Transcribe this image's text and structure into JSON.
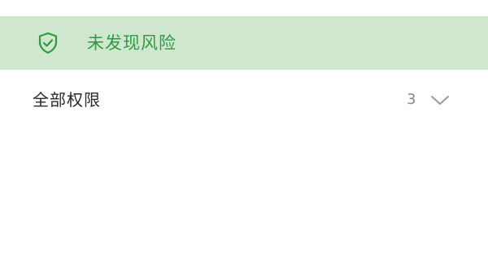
{
  "banner": {
    "status_icon": "shield-check-icon",
    "status_text": "未发现风险",
    "background_color": "#cfe7cf",
    "accent_color": "#2f9a44"
  },
  "permissions": {
    "label": "全部权限",
    "count": "3",
    "expand_icon": "chevron-down-icon"
  }
}
